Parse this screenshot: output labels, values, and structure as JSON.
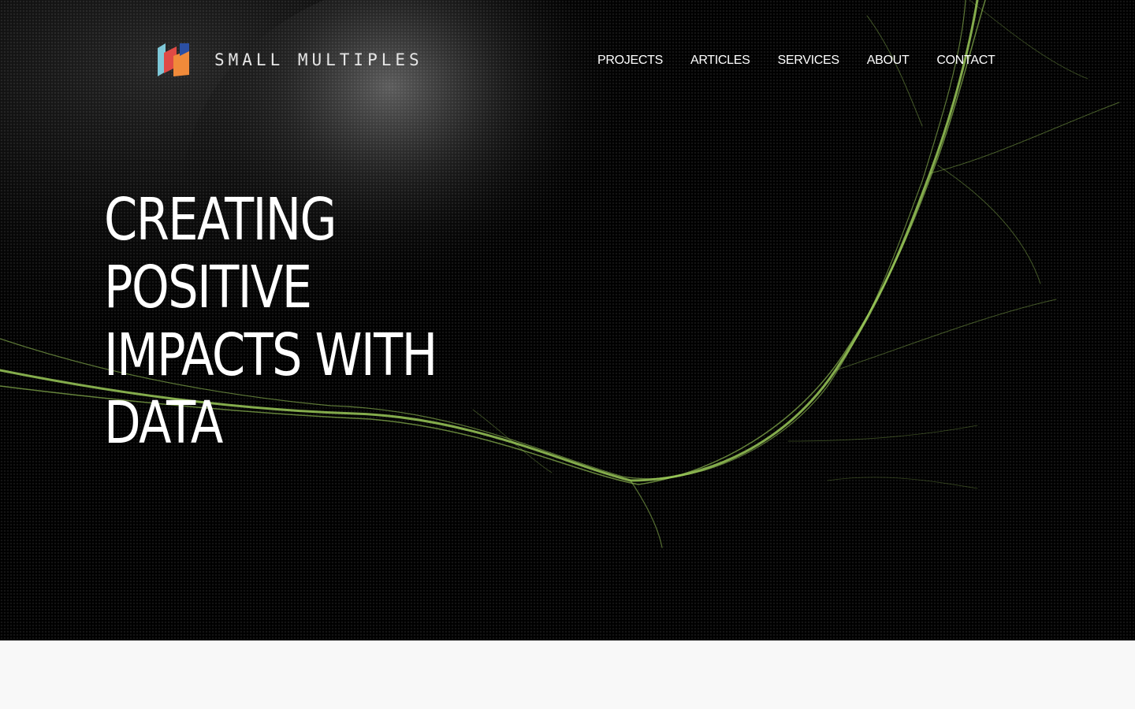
{
  "brand": {
    "name": "SMALL MULTIPLES",
    "logo_colors": [
      "#7ec8d8",
      "#e04a45",
      "#f08a3a",
      "#2b4fa3"
    ]
  },
  "nav": {
    "items": [
      {
        "label": "PROJECTS"
      },
      {
        "label": "ARTICLES"
      },
      {
        "label": "SERVICES"
      },
      {
        "label": "ABOUT"
      },
      {
        "label": "CONTACT"
      }
    ]
  },
  "hero": {
    "headline_lines": [
      "CREATING",
      "POSITIVE",
      "IMPACTS WITH",
      "DATA"
    ],
    "accent_color": "#a4d65e",
    "background_color": "#000000"
  }
}
